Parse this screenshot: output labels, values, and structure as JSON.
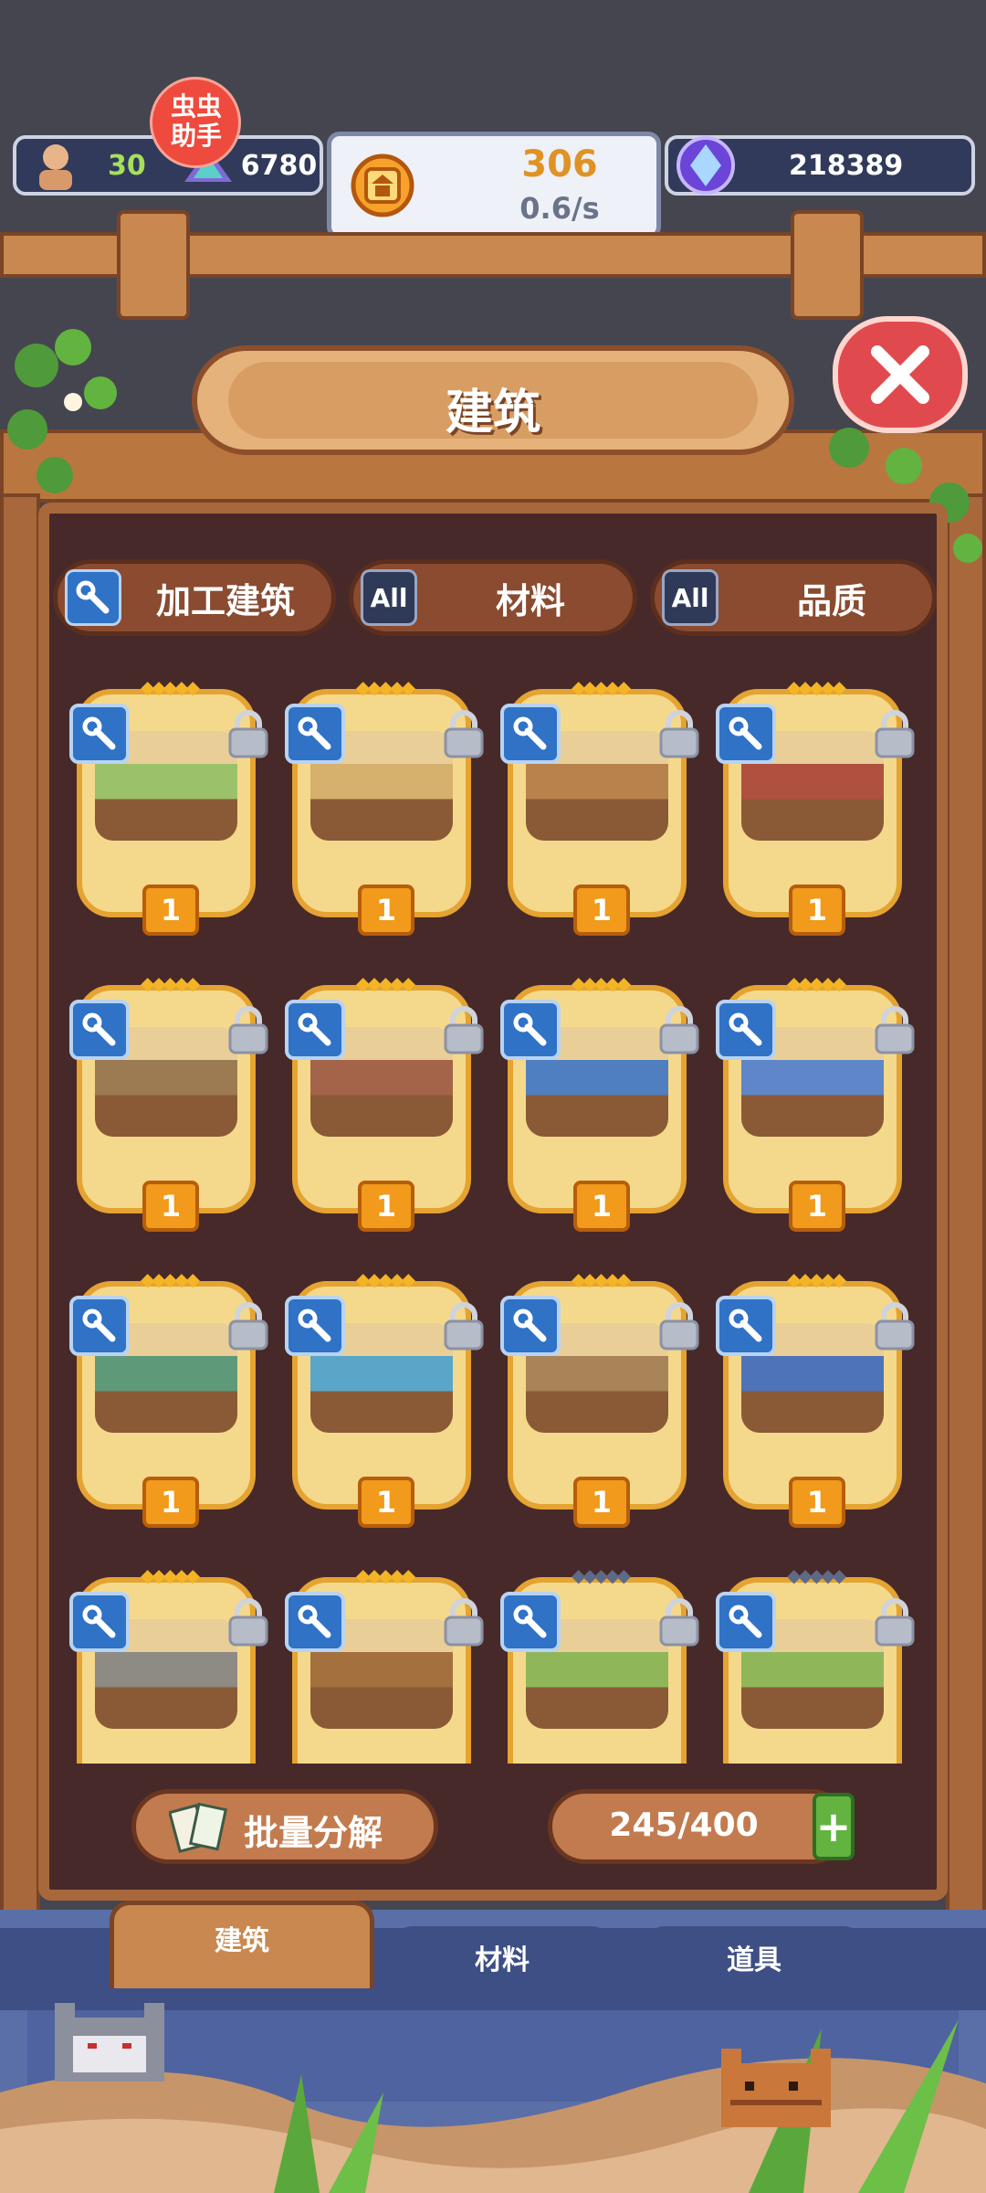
{
  "status": {
    "population": "30",
    "gems": "6780",
    "coins": "306",
    "coin_rate": "0.6/s",
    "crystals": "218389",
    "helper_badge": "虫虫助手"
  },
  "header": {
    "title": "建筑"
  },
  "filters": [
    {
      "label": "加工建筑",
      "icon": "wrench-icon"
    },
    {
      "label": "材料",
      "icon": "All"
    },
    {
      "label": "品质",
      "icon": "All"
    }
  ],
  "cards": [
    {
      "level": "1",
      "stars": "gold"
    },
    {
      "level": "1",
      "stars": "gold"
    },
    {
      "level": "1",
      "stars": "gold"
    },
    {
      "level": "1",
      "stars": "gold"
    },
    {
      "level": "1",
      "stars": "gold"
    },
    {
      "level": "1",
      "stars": "gold"
    },
    {
      "level": "1",
      "stars": "gold"
    },
    {
      "level": "1",
      "stars": "gold"
    },
    {
      "level": "1",
      "stars": "gold"
    },
    {
      "level": "1",
      "stars": "gold"
    },
    {
      "level": "1",
      "stars": "gold"
    },
    {
      "level": "1",
      "stars": "gold"
    },
    {
      "level": "",
      "stars": "gold"
    },
    {
      "level": "",
      "stars": "gold"
    },
    {
      "level": "",
      "stars": "grey"
    },
    {
      "level": "",
      "stars": "grey"
    }
  ],
  "footer": {
    "batch_label": "批量分解",
    "capacity": "245/400",
    "plus": "+"
  },
  "tabs": [
    {
      "label": "建筑",
      "active": true
    },
    {
      "label": "材料",
      "active": false
    },
    {
      "label": "道具",
      "active": false
    }
  ],
  "colors": {
    "wood": "#c9884f",
    "panel": "#47292a",
    "card": "#f4d98c",
    "badge": "#f19a1b",
    "wrench": "#2f72c6",
    "close": "#e04a4e"
  }
}
